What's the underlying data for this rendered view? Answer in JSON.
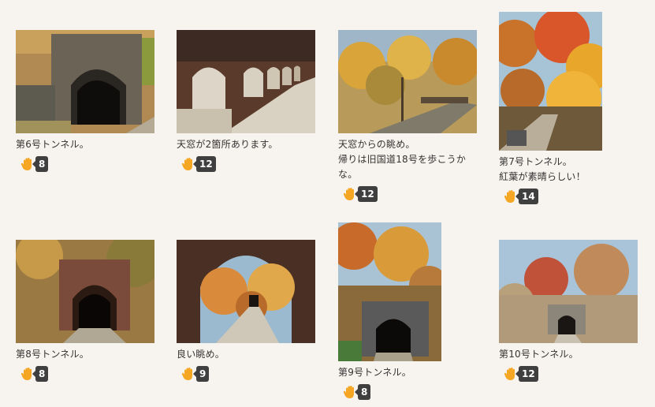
{
  "posts": [
    {
      "caption": "第6号トンネル。",
      "claps": "8",
      "scene": "tunnel-autumn-brick"
    },
    {
      "caption": "天窓が2箇所あります。",
      "claps": "12",
      "scene": "arches-corridor"
    },
    {
      "caption": "天窓からの眺め。\n帰りは旧国道18号を歩こうかな。",
      "claps": "12",
      "scene": "autumn-path"
    },
    {
      "caption": "第7号トンネル。\n紅葉が素晴らしい！",
      "claps": "14",
      "scene": "autumn-trees-tall"
    },
    {
      "caption": "第8号トンネル。",
      "claps": "8",
      "scene": "dark-tunnel"
    },
    {
      "caption": "良い眺め。",
      "claps": "9",
      "scene": "arch-view"
    },
    {
      "caption": "第9号トンネル。",
      "claps": "8",
      "scene": "tunnel-tall-autumn"
    },
    {
      "caption": "第10号トンネル。",
      "claps": "12",
      "scene": "tunnel-distant"
    }
  ],
  "icons": {
    "clap": "clap-hand-icon"
  },
  "colors": {
    "background": "#f7f3ee",
    "badge": "#3f3f3f",
    "hand": "#f5a623"
  }
}
